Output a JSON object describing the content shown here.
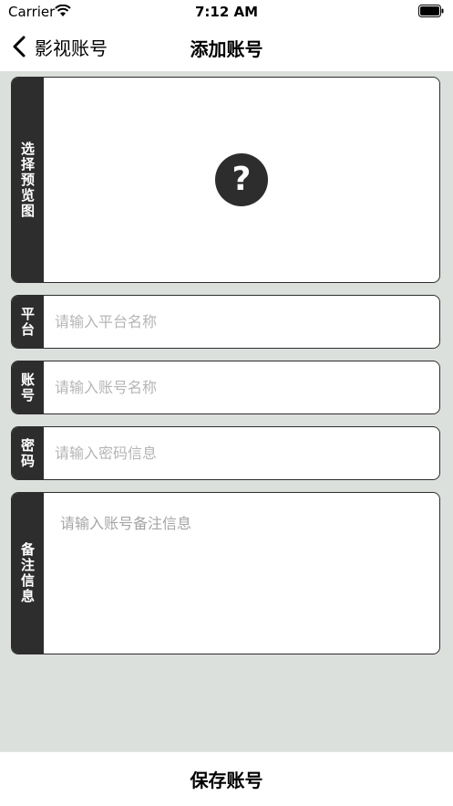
{
  "status_bar": {
    "carrier": "Carrier",
    "time": "7:12 AM",
    "wifi_icon": "wifi-icon",
    "battery_icon": "battery-icon"
  },
  "nav": {
    "back_label": "影视账号",
    "back_icon": "chevron-left-icon",
    "title": "添加账号"
  },
  "preview": {
    "label": "选择预览图",
    "icon": "question-icon",
    "icon_glyph": "?"
  },
  "fields": {
    "platform": {
      "label": "平台",
      "placeholder": "请输入平台名称",
      "value": ""
    },
    "account": {
      "label": "账号",
      "placeholder": "请输入账号名称",
      "value": ""
    },
    "password": {
      "label": "密码",
      "placeholder": "请输入密码信息",
      "value": ""
    },
    "remark": {
      "label": "备注信息",
      "placeholder": "请输入账号备注信息",
      "value": ""
    }
  },
  "footer": {
    "save_label": "保存账号"
  },
  "colors": {
    "dark": "#2d2d2d",
    "background": "#dce0dd",
    "placeholder": "#b5b5b5"
  }
}
